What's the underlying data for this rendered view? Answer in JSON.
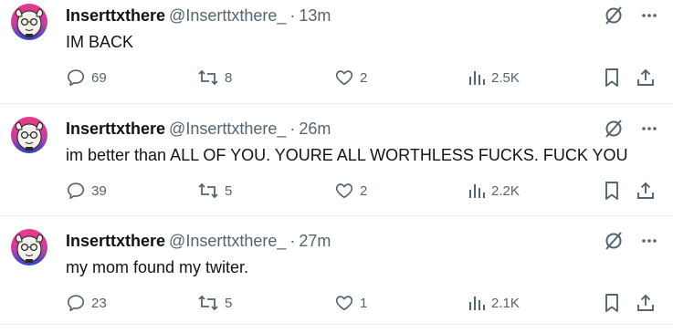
{
  "tweets": [
    {
      "name": "Inserttxthere",
      "handle": "@Inserttxthere_",
      "separator": "·",
      "time": "13m",
      "text": "IM BACK",
      "replies": "69",
      "reposts": "8",
      "likes": "2",
      "views": "2.5K"
    },
    {
      "name": "Inserttxthere",
      "handle": "@Inserttxthere_",
      "separator": "·",
      "time": "26m",
      "text": "im better than ALL OF YOU. YOURE ALL WORTHLESS FUCKS. FUCK YOU",
      "replies": "39",
      "reposts": "5",
      "likes": "2",
      "views": "2.2K"
    },
    {
      "name": "Inserttxthere",
      "handle": "@Inserttxthere_",
      "separator": "·",
      "time": "27m",
      "text": "my mom found my twiter.",
      "replies": "23",
      "reposts": "5",
      "likes": "1",
      "views": "2.1K"
    }
  ],
  "icons": {
    "reply": "speech-bubble-icon",
    "repost": "repost-arrows-icon",
    "like": "heart-icon",
    "views": "bar-chart-icon",
    "bookmark": "bookmark-icon",
    "share": "share-upload-icon",
    "grok": "grok-slash-icon",
    "more": "more-dots-icon"
  },
  "colors": {
    "text": "#0f1419",
    "secondary": "#536471",
    "divider": "#eff3f4",
    "avatar_bg_top": "#e63a87",
    "avatar_bg_bottom": "#2a46c8"
  }
}
